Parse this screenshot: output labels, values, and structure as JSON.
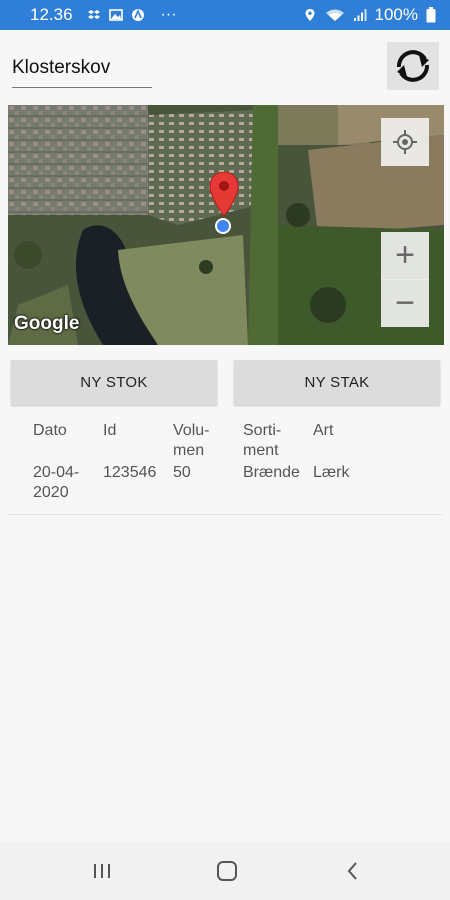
{
  "status_bar": {
    "time": "12.36",
    "dots": "···",
    "battery_text": "100%",
    "icons": [
      "dropbox-icon",
      "gallery-icon",
      "app-icon",
      "location-icon",
      "wifi-icon",
      "signal-icon",
      "battery-icon"
    ]
  },
  "header": {
    "location_value": "Klosterskov",
    "sync_icon": "sync-icon"
  },
  "map": {
    "provider_logo": "Google",
    "zoom_in": "+",
    "zoom_out": "−",
    "controls": [
      "locate-icon"
    ]
  },
  "actions": {
    "new_stok_label": "NY STOK",
    "new_stak_label": "NY STAK"
  },
  "table": {
    "columns": [
      "Dato",
      "Id",
      "Volu-\nmen",
      "Sorti-\nment",
      "Art"
    ],
    "rows": [
      [
        "20-04-\n2020",
        "123546",
        "50",
        "Brænde",
        "Lærk"
      ]
    ]
  },
  "colors": {
    "status_bar": "#2f7fd8",
    "marker": "#e53935",
    "my_location": "#4285f4"
  }
}
